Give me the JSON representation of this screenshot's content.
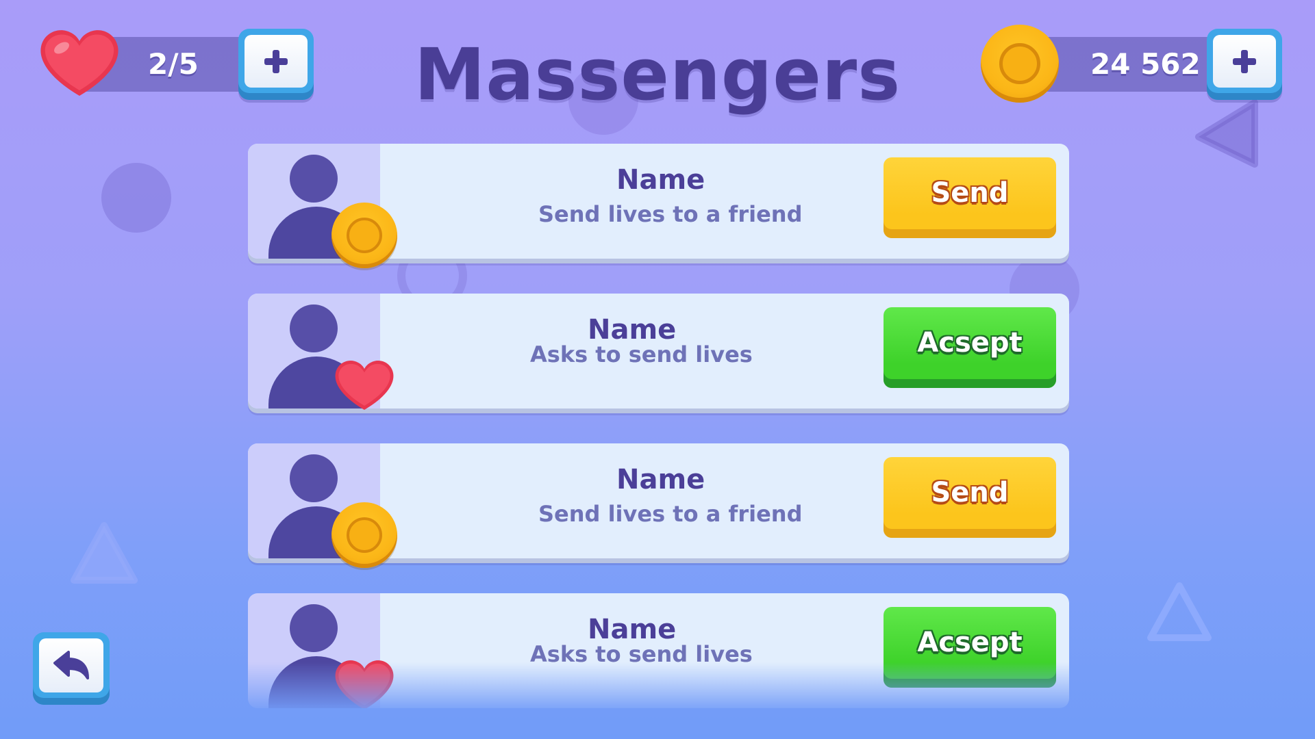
{
  "header": {
    "title": "Massengers",
    "lives": "2/5",
    "coins": "24 562"
  },
  "messages": [
    {
      "name": "Name",
      "subtitle": "Send lives to a friend",
      "badge": "coin-icon",
      "button": "Send",
      "button_type": "send"
    },
    {
      "name": "Name",
      "subtitle": "Asks to send lives",
      "badge": "heart-icon",
      "button": "Acsept",
      "button_type": "accept"
    },
    {
      "name": "Name",
      "subtitle": "Send lives to a friend",
      "badge": "coin-icon",
      "button": "Send",
      "button_type": "send"
    },
    {
      "name": "Name",
      "subtitle": "Asks to send lives",
      "badge": "heart-icon",
      "button": "Acsept",
      "button_type": "accept"
    }
  ],
  "colors": {
    "title": "#4a3e96",
    "send_button": "#fcc51c",
    "accept_button": "#3ed22a",
    "card_background": "#e2eefd"
  },
  "icons": [
    "heart-icon",
    "plus-icon",
    "coin-icon",
    "avatar-icon",
    "back-arrow-icon"
  ]
}
